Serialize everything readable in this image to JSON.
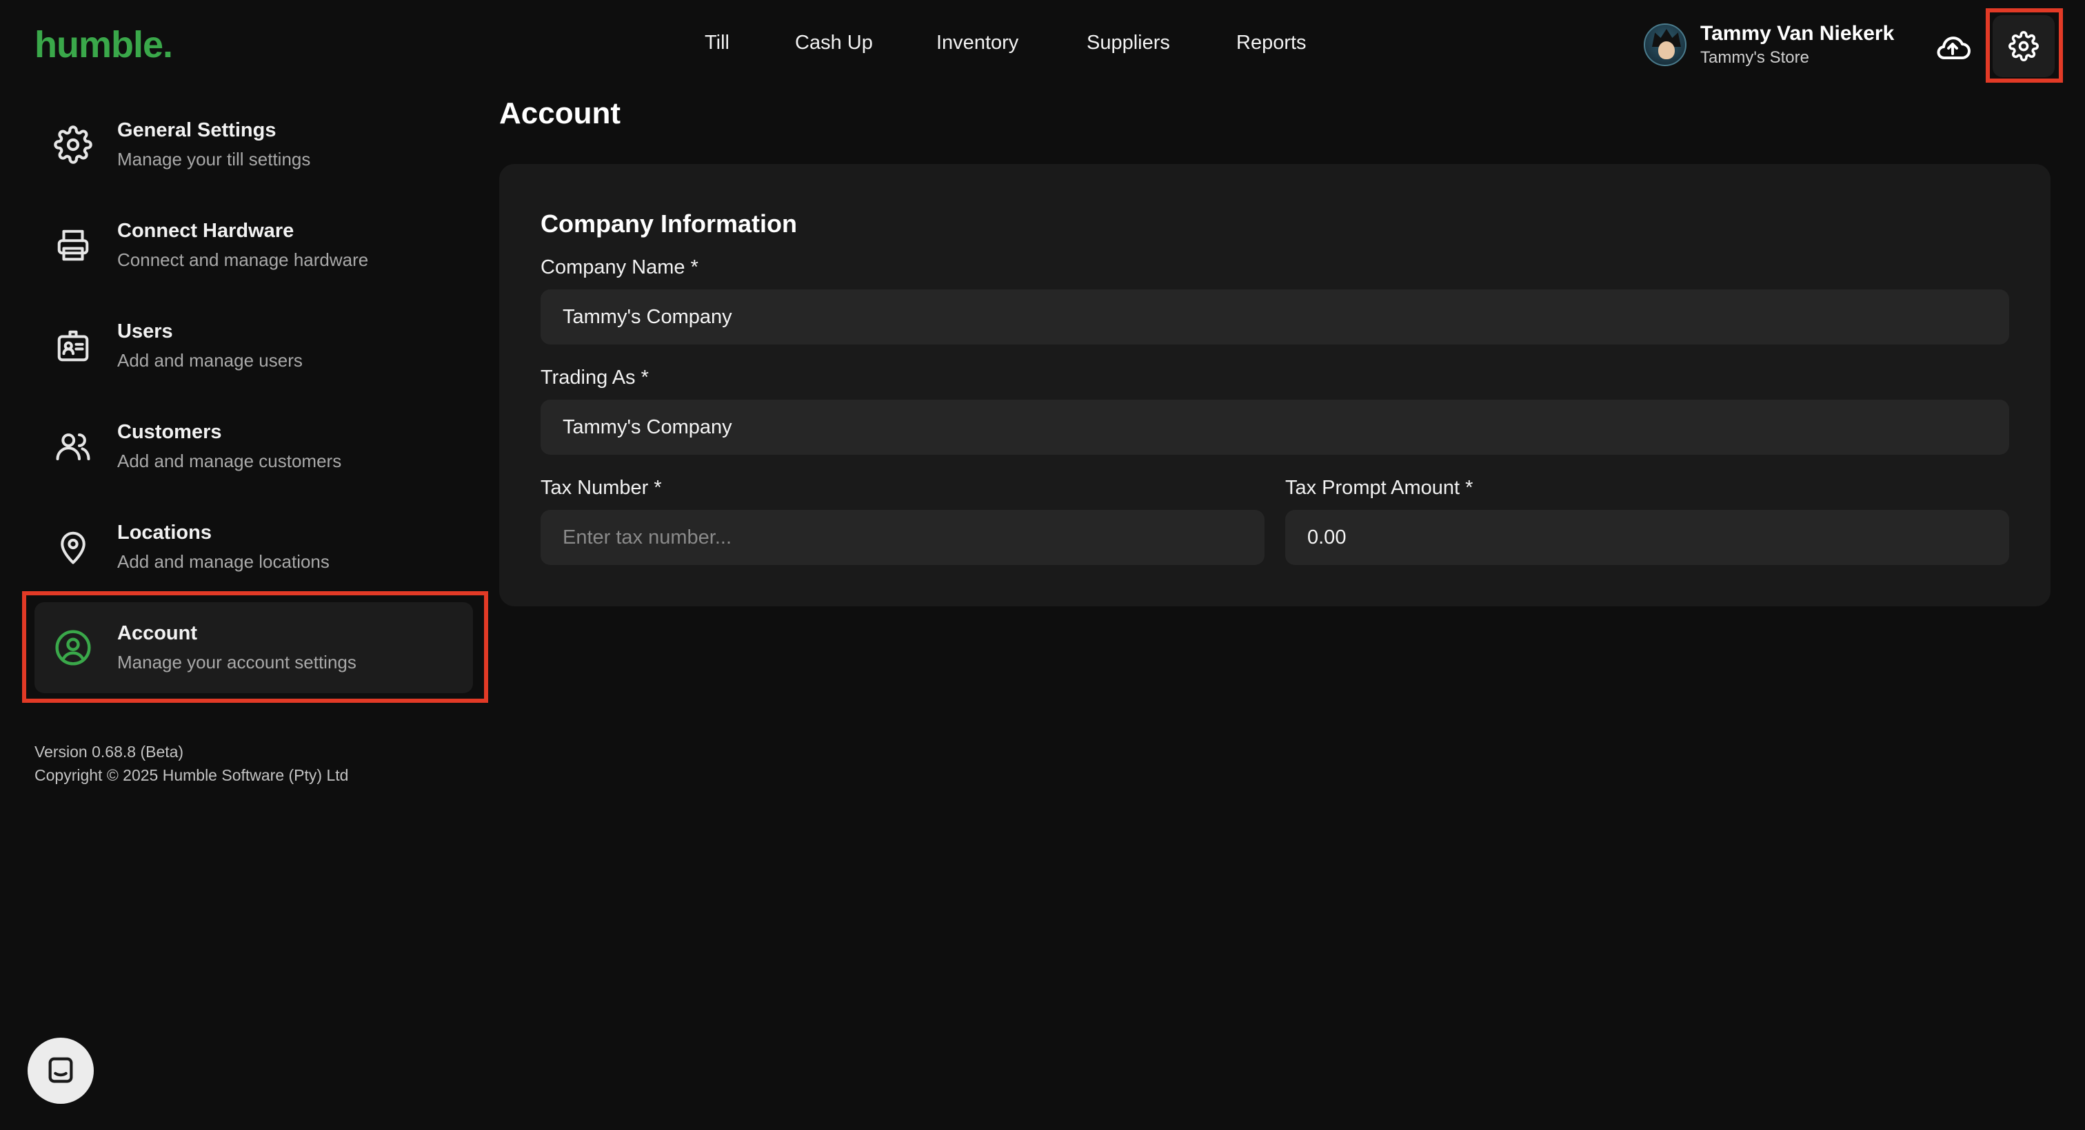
{
  "header": {
    "logo": "humble.",
    "nav": [
      {
        "label": "Till"
      },
      {
        "label": "Cash Up"
      },
      {
        "label": "Inventory"
      },
      {
        "label": "Suppliers"
      },
      {
        "label": "Reports"
      }
    ],
    "user": {
      "name": "Tammy Van Niekerk",
      "store": "Tammy's Store"
    }
  },
  "sidebar": {
    "items": [
      {
        "title": "General Settings",
        "subtitle": "Manage your till settings",
        "icon": "gear-icon"
      },
      {
        "title": "Connect Hardware",
        "subtitle": "Connect and manage hardware",
        "icon": "printer-icon"
      },
      {
        "title": "Users",
        "subtitle": "Add and manage users",
        "icon": "id-badge-icon"
      },
      {
        "title": "Customers",
        "subtitle": "Add and manage customers",
        "icon": "people-icon"
      },
      {
        "title": "Locations",
        "subtitle": "Add and manage locations",
        "icon": "location-pin-icon"
      },
      {
        "title": "Account",
        "subtitle": "Manage your account settings",
        "icon": "user-circle-icon",
        "active": true
      }
    ],
    "version": "Version 0.68.8 (Beta)",
    "copyright": "Copyright © 2025 Humble Software (Pty) Ltd"
  },
  "main": {
    "title": "Account",
    "section_title": "Company Information",
    "fields": {
      "company_name": {
        "label": "Company Name *",
        "value": "Tammy's Company"
      },
      "trading_as": {
        "label": "Trading As *",
        "value": "Tammy's Company"
      },
      "tax_number": {
        "label": "Tax Number *",
        "value": "",
        "placeholder": "Enter tax number..."
      },
      "tax_prompt_amount": {
        "label": "Tax Prompt Amount *",
        "value": "0.00"
      }
    }
  },
  "colors": {
    "accent": "#3aa84a",
    "highlight": "#e23a26",
    "background": "#0e0e0e",
    "card": "#1a1a1a"
  }
}
